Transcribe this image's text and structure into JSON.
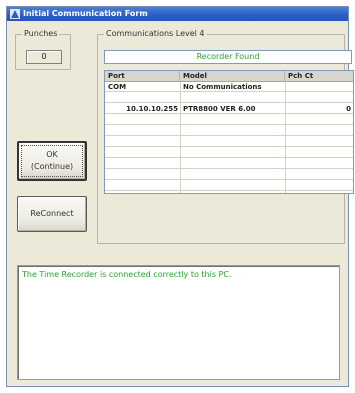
{
  "window": {
    "title": "Initial Communication Form"
  },
  "punches": {
    "legend": "Punches",
    "value": "0"
  },
  "comms": {
    "legend": "Communications Level 4",
    "status": "Recorder Found",
    "columns": [
      "Port",
      "Model",
      "Pch Ct"
    ],
    "rows": [
      [
        "COM",
        "No Communications",
        ""
      ],
      [
        "",
        "",
        ""
      ],
      [
        "10.10.10.255",
        "PTR8800 VER 6.00",
        "0"
      ],
      [
        "",
        "",
        ""
      ],
      [
        "",
        "",
        ""
      ],
      [
        "",
        "",
        ""
      ],
      [
        "",
        "",
        ""
      ],
      [
        "",
        "",
        ""
      ],
      [
        "",
        "",
        ""
      ],
      [
        "",
        "",
        ""
      ],
      [
        "",
        "",
        ""
      ]
    ]
  },
  "buttons": {
    "ok_line1": "OK",
    "ok_line2": "(Continue)",
    "reconnect": "ReConnect"
  },
  "message": "The Time Recorder is connected correctly to this PC.",
  "colors": {
    "status_text": "#2d9d3a",
    "titlebar": "#2a5ec4"
  },
  "icons": {
    "title": "app-icon"
  }
}
